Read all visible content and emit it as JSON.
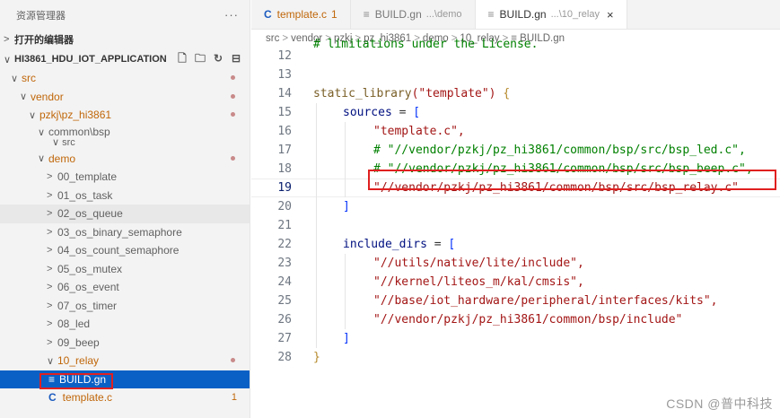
{
  "sidebar": {
    "title": "资源管理器",
    "more": "···",
    "open_editors": "打开的编辑器",
    "project": "HI3861_HDU_IOT_APPLICATION",
    "tree": [
      {
        "label": "src",
        "chev": "∨",
        "dot": true
      },
      {
        "label": "vendor",
        "chev": "∨",
        "dot": true
      },
      {
        "label": "pzkj\\pz_hi3861",
        "chev": "∨",
        "dot": true
      },
      {
        "label": "common\\bsp",
        "chev": "∨",
        "sub": "src"
      },
      {
        "label": "demo",
        "chev": "∨",
        "dot": true
      },
      {
        "label": "00_template",
        "chev": ">"
      },
      {
        "label": "01_os_task",
        "chev": ">"
      },
      {
        "label": "02_os_queue",
        "chev": ">"
      },
      {
        "label": "03_os_binary_semaphore",
        "chev": ">"
      },
      {
        "label": "04_os_count_semaphore",
        "chev": ">"
      },
      {
        "label": "05_os_mutex",
        "chev": ">"
      },
      {
        "label": "06_os_event",
        "chev": ">"
      },
      {
        "label": "07_os_timer",
        "chev": ">"
      },
      {
        "label": "08_led",
        "chev": ">"
      },
      {
        "label": "09_beep",
        "chev": ">"
      },
      {
        "label": "10_relay",
        "chev": "∨",
        "dot": true
      },
      {
        "label": "BUILD.gn",
        "icon": "≡"
      },
      {
        "label": "template.c",
        "icon": "C",
        "count": "1"
      }
    ]
  },
  "tabs": [
    {
      "icon": "C",
      "label": "template.c",
      "suffix": "1"
    },
    {
      "icon": "≡",
      "label": "BUILD.gn",
      "suffix": "...\\demo"
    },
    {
      "icon": "≡",
      "label": "BUILD.gn",
      "suffix": "...\\10_relay",
      "close": "×"
    }
  ],
  "breadcrumb": [
    "src",
    "vendor",
    "pzkj",
    "pz_hi3861",
    "demo",
    "10_relay",
    "≡ BUILD.gn"
  ],
  "code": {
    "line12": "# limitations under the License.",
    "static_library": "static_library",
    "template_name": "(\"template\")",
    "open_brace": "{",
    "sources": "sources",
    "eq": " = ",
    "open_bracket": "[",
    "src_template": "\"template.c\",",
    "com_led": "# \"//vendor/pzkj/pz_hi3861/common/bsp/src/bsp_led.c\",",
    "com_beep": "# \"//vendor/pzkj/pz_hi3861/common/bsp/src/bsp_beep.c\",",
    "src_relay": "\"//vendor/pzkj/pz_hi3861/common/bsp/src/bsp_relay.c\"",
    "close_bracket": "]",
    "include_dirs": "include_dirs",
    "inc1": "\"//utils/native/lite/include\",",
    "inc2": "\"//kernel/liteos_m/kal/cmsis\",",
    "inc3": "\"//base/iot_hardware/peripheral/interfaces/kits\",",
    "inc4": "\"//vendor/pzkj/pz_hi3861/common/bsp/include\"",
    "close_brace": "}"
  },
  "line_numbers": [
    "12",
    "13",
    "14",
    "15",
    "16",
    "17",
    "18",
    "19",
    "20",
    "21",
    "22",
    "23",
    "24",
    "25",
    "26",
    "27",
    "28"
  ],
  "watermark": "CSDN @普中科技"
}
